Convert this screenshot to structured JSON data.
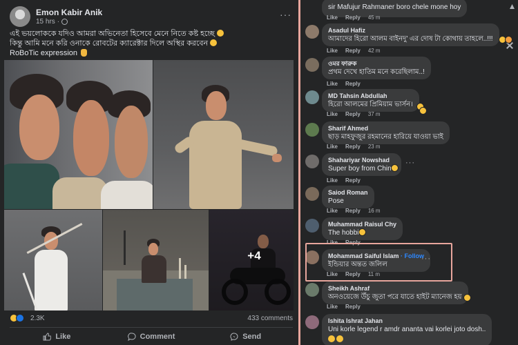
{
  "post": {
    "author": "Emon Kabir Anik",
    "time": "15 hrs",
    "caption_lines": [
      "এই ভয়লোককে যদিও আমরা অভিনেতা হিসেবে মেনে নিতে কষ্ট হচ্ছে",
      "কিন্তু আমি মনে করি ওনাকে রোবটের ক্যারেক্টার দিলে অস্থির করবেন",
      "RoBoTic expression"
    ],
    "more_photos": "+4",
    "reaction_count": "2.3K",
    "comments_count": "433 comments",
    "actions": {
      "like": "Like",
      "comment": "Comment",
      "send": "Send"
    },
    "colors": {
      "accent": "#1b74e4",
      "background": "#242526"
    }
  },
  "comments": [
    {
      "name": "",
      "text": "sir Mafujur Rahmaner boro chele mone hoy",
      "time": "45 m",
      "like": "Like",
      "reply": "Reply",
      "avatar_color": "#6b7f8e"
    },
    {
      "name": "Asadul Hafiz",
      "text": "আমাদের হিরো আলম বাইনদু' এর দোষ টা কোথায় তাহলে..!!!",
      "time": "42 m",
      "like": "Like",
      "reply": "Reply",
      "avatar_color": "#8d7a6a"
    },
    {
      "name": "ওমর ফারুক",
      "text": "প্রথম দেখে হাতিম মনে করেছিলাম..!",
      "time": "",
      "like": "Like",
      "reply": "Reply",
      "avatar_color": "#7a6d5e"
    },
    {
      "name": "MD Tahsin Abdullah",
      "text": "হিরো আলমের প্রিমিয়াম ভার্সন।",
      "time": "37 m",
      "like": "Like",
      "reply": "Reply",
      "avatar_color": "#6e8a8e"
    },
    {
      "name": "Sharif Ahmed",
      "text": "ছাড় মাহফুজুর রহমানের হারিয়ে যাওয়া ভাই",
      "time": "23 m",
      "like": "Like",
      "reply": "Reply",
      "avatar_color": "#5d7a4e"
    },
    {
      "name": "Shahariyar Nowshad",
      "text": "Super boy from China",
      "time": "",
      "like": "Like",
      "reply": "Reply",
      "avatar_color": "#6f6c6a"
    },
    {
      "name": "Saiod Roman",
      "text": "Pose",
      "time": "16 m",
      "like": "Like",
      "reply": "Reply",
      "avatar_color": "#7a6a5a"
    },
    {
      "name": "Muhammad Raisul Chy",
      "text": "The hobbit",
      "time": "",
      "like": "Like",
      "reply": "Reply",
      "avatar_color": "#4e5e6e"
    },
    {
      "name": "Mohammad Saiful Islam",
      "follow": "· Follow",
      "text": "ইন্ডিয়ার অন্তত জলিল",
      "time": "11 m",
      "like": "Like",
      "reply": "Reply",
      "avatar_color": "#8a7060"
    },
    {
      "name": "Sheikh Ashraf",
      "text": "অনওয়েজে উঁচু জুতা পরে যাতে হাইট ম্যানেজ হয়",
      "time": "",
      "like": "Like",
      "reply": "Reply",
      "avatar_color": "#6a7a6a"
    },
    {
      "name": "Ishita Ishrat Jahan",
      "text": "Uni korle legend r amdr ananta vai korlei joto dosh..",
      "time": "",
      "like": "",
      "reply": "",
      "avatar_color": "#8e6a7a"
    }
  ]
}
